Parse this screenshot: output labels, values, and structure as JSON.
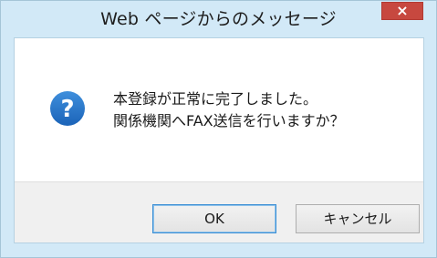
{
  "window": {
    "title": "Web ページからのメッセージ",
    "close_glyph": "×"
  },
  "dialog": {
    "icon": "question-icon",
    "message_line1": "本登録が正常に完了しました。",
    "message_line2": "関係機関へFAX送信を行いますか？"
  },
  "buttons": {
    "ok_label": "OK",
    "cancel_label": "キャンセル"
  },
  "colors": {
    "title_bar": "#d2e9f7",
    "close_button": "#c7483f",
    "icon_fill": "#2472c8",
    "button_bar": "#f0f0f0"
  }
}
